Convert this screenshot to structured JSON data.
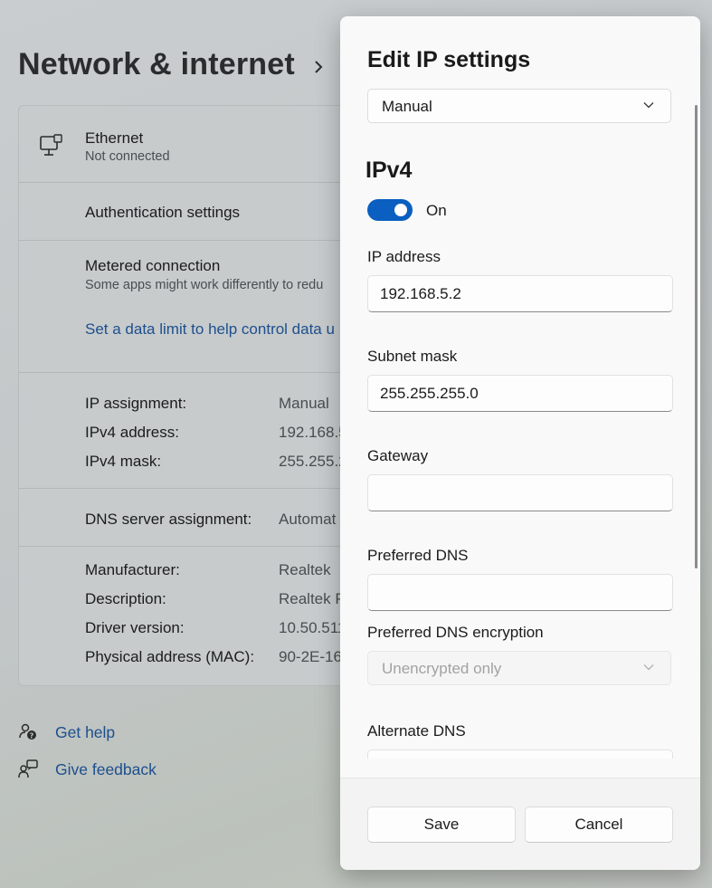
{
  "background": {
    "page_title": "Network & internet",
    "ethernet": {
      "name": "Ethernet",
      "status": "Not connected"
    },
    "auth_settings": "Authentication settings",
    "metered": {
      "title": "Metered connection",
      "description": "Some apps might work differently to redu",
      "data_limit_link": "Set a data limit to help control data u"
    },
    "ip_info": [
      {
        "label": "IP assignment:",
        "value": "Manual"
      },
      {
        "label": "IPv4 address:",
        "value": "192.168.5"
      },
      {
        "label": "IPv4 mask:",
        "value": "255.255.2"
      }
    ],
    "dns": {
      "label": "DNS server assignment:",
      "value": "Automat"
    },
    "hw_info": [
      {
        "label": "Manufacturer:",
        "value": "Realtek"
      },
      {
        "label": "Description:",
        "value": "Realtek P"
      },
      {
        "label": "Driver version:",
        "value": "10.50.511."
      },
      {
        "label": "Physical address (MAC):",
        "value": "90-2E-16"
      }
    ],
    "get_help": "Get help",
    "give_feedback": "Give feedback"
  },
  "dialog": {
    "title": "Edit IP settings",
    "mode_select": "Manual",
    "section": "IPv4",
    "toggle": {
      "label": "On",
      "state": true
    },
    "ip_address": {
      "label": "IP address",
      "value": "192.168.5.2"
    },
    "subnet_mask": {
      "label": "Subnet mask",
      "value": "255.255.255.0"
    },
    "gateway": {
      "label": "Gateway",
      "value": ""
    },
    "preferred_dns": {
      "label": "Preferred DNS",
      "value": ""
    },
    "preferred_dns_encryption": {
      "label": "Preferred DNS encryption",
      "value": "Unencrypted only"
    },
    "alternate_dns": {
      "label": "Alternate DNS",
      "value": ""
    },
    "save_label": "Save",
    "cancel_label": "Cancel"
  },
  "colors": {
    "accent": "#0a5fc0",
    "link": "#1d4f8e"
  }
}
